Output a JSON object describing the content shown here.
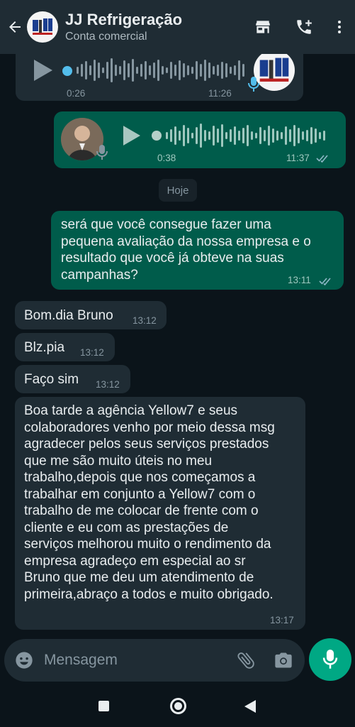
{
  "header": {
    "title": "JJ Refrigeração",
    "subtitle": "Conta comercial"
  },
  "voice_in": {
    "duration": "0:26",
    "time": "11:26",
    "progress": 0
  },
  "voice_out": {
    "duration": "0:38",
    "time": "11:37",
    "progress": 0
  },
  "date_divider": "Hoje",
  "messages": [
    {
      "direction": "out",
      "lines": [
        "será que você consegue fazer uma",
        "pequena avaliação da nossa empresa e o",
        "resultado que você já obteve na suas",
        "campanhas?"
      ],
      "time": "13:11"
    },
    {
      "direction": "in",
      "lines": [
        "Bom.dia Bruno"
      ],
      "time": "13:12"
    },
    {
      "direction": "in",
      "lines": [
        "Blz.pia"
      ],
      "time": "13:12"
    },
    {
      "direction": "in",
      "lines": [
        "Faço sim"
      ],
      "time": "13:12"
    },
    {
      "direction": "in",
      "lines": [
        "Boa tarde a agência Yellow7 e seus",
        "colaboradores venho por meio dessa msg",
        "agradecer pelos seus serviços prestados",
        "que me são muito úteis no meu",
        "trabalho,depois que nos começamos a",
        "trabalhar em conjunto a Yellow7 com o",
        "trabalho de me colocar de frente com o",
        "cliente e eu com as prestações de",
        "serviços melhorou muito o rendimento da",
        "empresa agradeço em especial ao sr",
        "Bruno que me deu um atendimento de",
        "primeira,abraço a todos e muito obrigado."
      ],
      "time": "13:17"
    }
  ],
  "composer": {
    "placeholder": "Mensagem"
  },
  "colors": {
    "header_bg": "#1f2c34",
    "chat_bg": "#0b141a",
    "incoming_bubble": "#1f2c34",
    "outgoing_bubble": "#005c4b",
    "accent": "#00a884",
    "read_ticks": "#8fb8c8"
  },
  "icons": [
    "back-arrow-icon",
    "store-icon",
    "add-call-icon",
    "more-vert-icon",
    "play-icon",
    "mic-icon",
    "read-ticks-icon",
    "emoji-icon",
    "attach-icon",
    "camera-icon",
    "nav-square-icon",
    "nav-circle-icon",
    "nav-back-triangle-icon"
  ]
}
